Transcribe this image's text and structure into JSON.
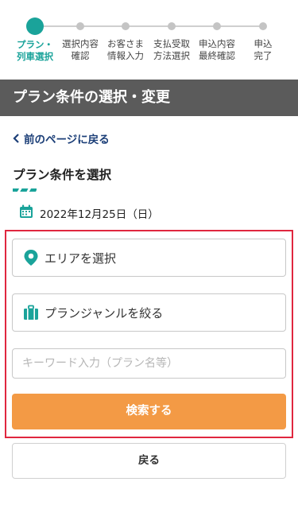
{
  "stepper": {
    "steps": [
      {
        "label": "プラン・\n列車選択",
        "active": true
      },
      {
        "label": "選択内容\n確認",
        "active": false
      },
      {
        "label": "お客さま\n情報入力",
        "active": false
      },
      {
        "label": "支払受取\n方法選択",
        "active": false
      },
      {
        "label": "申込内容\n最終確認",
        "active": false
      },
      {
        "label": "申込\n完了",
        "active": false
      }
    ]
  },
  "header": {
    "title": "プラン条件の選択・変更"
  },
  "back_link": {
    "label": "前のページに戻る"
  },
  "section": {
    "title": "プラン条件を選択"
  },
  "date": {
    "text": "2022年12月25日（日）"
  },
  "search": {
    "area_label": "エリアを選択",
    "genre_label": "プランジャンルを絞る",
    "keyword_placeholder": "キーワード入力（プラン名等）",
    "keyword_value": "",
    "submit_label": "検索する"
  },
  "footer": {
    "back_label": "戻る"
  },
  "colors": {
    "accent": "#1aa39a",
    "header_bg": "#5b5b5b",
    "search_button": "#f39a45",
    "highlight_border": "#e0273f",
    "link": "#1c3f78"
  },
  "icons": {
    "area": "map-pin-icon",
    "genre": "suitcase-icon",
    "date": "calendar-icon",
    "back": "chevron-left-icon"
  }
}
